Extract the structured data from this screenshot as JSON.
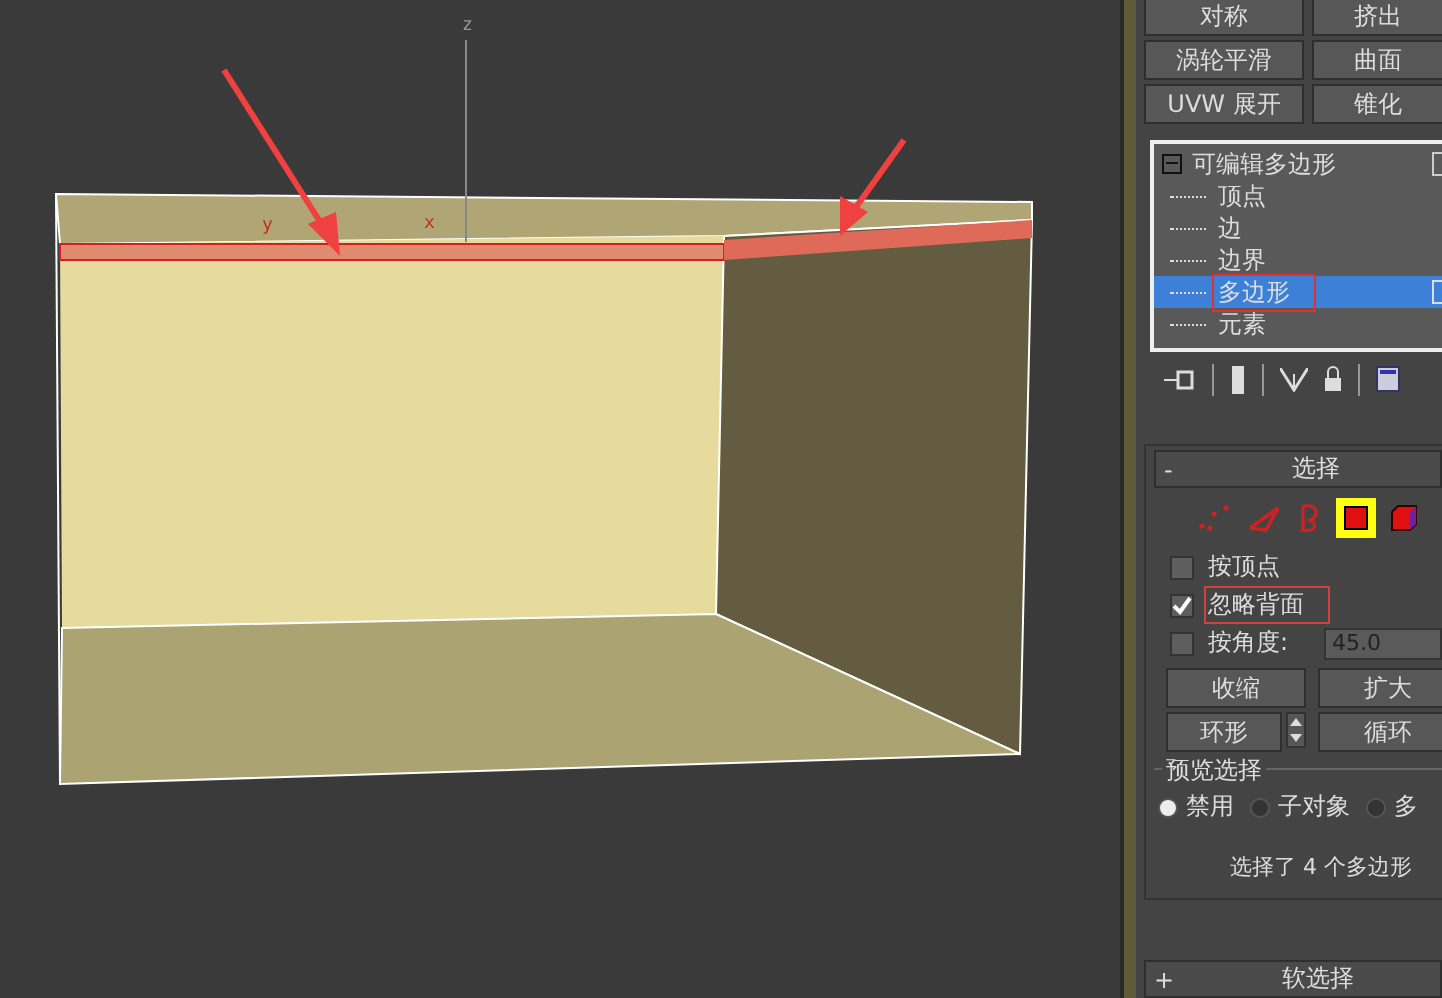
{
  "viewport": {
    "axis_labels": [
      {
        "kind": "z",
        "text": "z"
      },
      {
        "kind": "y",
        "text": "y"
      },
      {
        "kind": "x",
        "text": "x"
      }
    ]
  },
  "modifier_buttons": [
    {
      "label": "对称"
    },
    {
      "label": "挤出"
    },
    {
      "label": "涡轮平滑"
    },
    {
      "label": "曲面"
    },
    {
      "label": "UVW 展开"
    },
    {
      "label": "锥化"
    }
  ],
  "modifier_stack": {
    "label": "可编辑多边形",
    "expanded": true,
    "children": [
      {
        "label": "顶点",
        "selected": false
      },
      {
        "label": "边",
        "selected": false
      },
      {
        "label": "边界",
        "selected": false
      },
      {
        "label": "多边形",
        "selected": true
      },
      {
        "label": "元素",
        "selected": false
      }
    ]
  },
  "selection_rollout": {
    "sign": "-",
    "title": "选择",
    "subobject_levels": [
      {
        "kind": "vertex",
        "selected": false
      },
      {
        "kind": "edge",
        "selected": false
      },
      {
        "kind": "border",
        "selected": false
      },
      {
        "kind": "polygon",
        "selected": true
      },
      {
        "kind": "element",
        "selected": false
      }
    ],
    "options": [
      {
        "label": "按顶点",
        "checked": false
      },
      {
        "label": "忽略背面",
        "checked": true
      },
      {
        "label": "按角度:",
        "checked": false,
        "value": "45.0"
      }
    ],
    "buttons": [
      {
        "label": "收缩"
      },
      {
        "label": "扩大"
      },
      {
        "label": "环形"
      },
      {
        "label": "循环"
      }
    ],
    "preview_selection": {
      "title": "预览选择",
      "options": [
        {
          "label": "禁用",
          "selected": true
        },
        {
          "label": "子对象",
          "selected": false
        },
        {
          "label": "多",
          "selected": false
        }
      ]
    },
    "status": "选择了 4 个多边形"
  },
  "soft_selection_rollout": {
    "sign": "+",
    "title": "软选择"
  }
}
